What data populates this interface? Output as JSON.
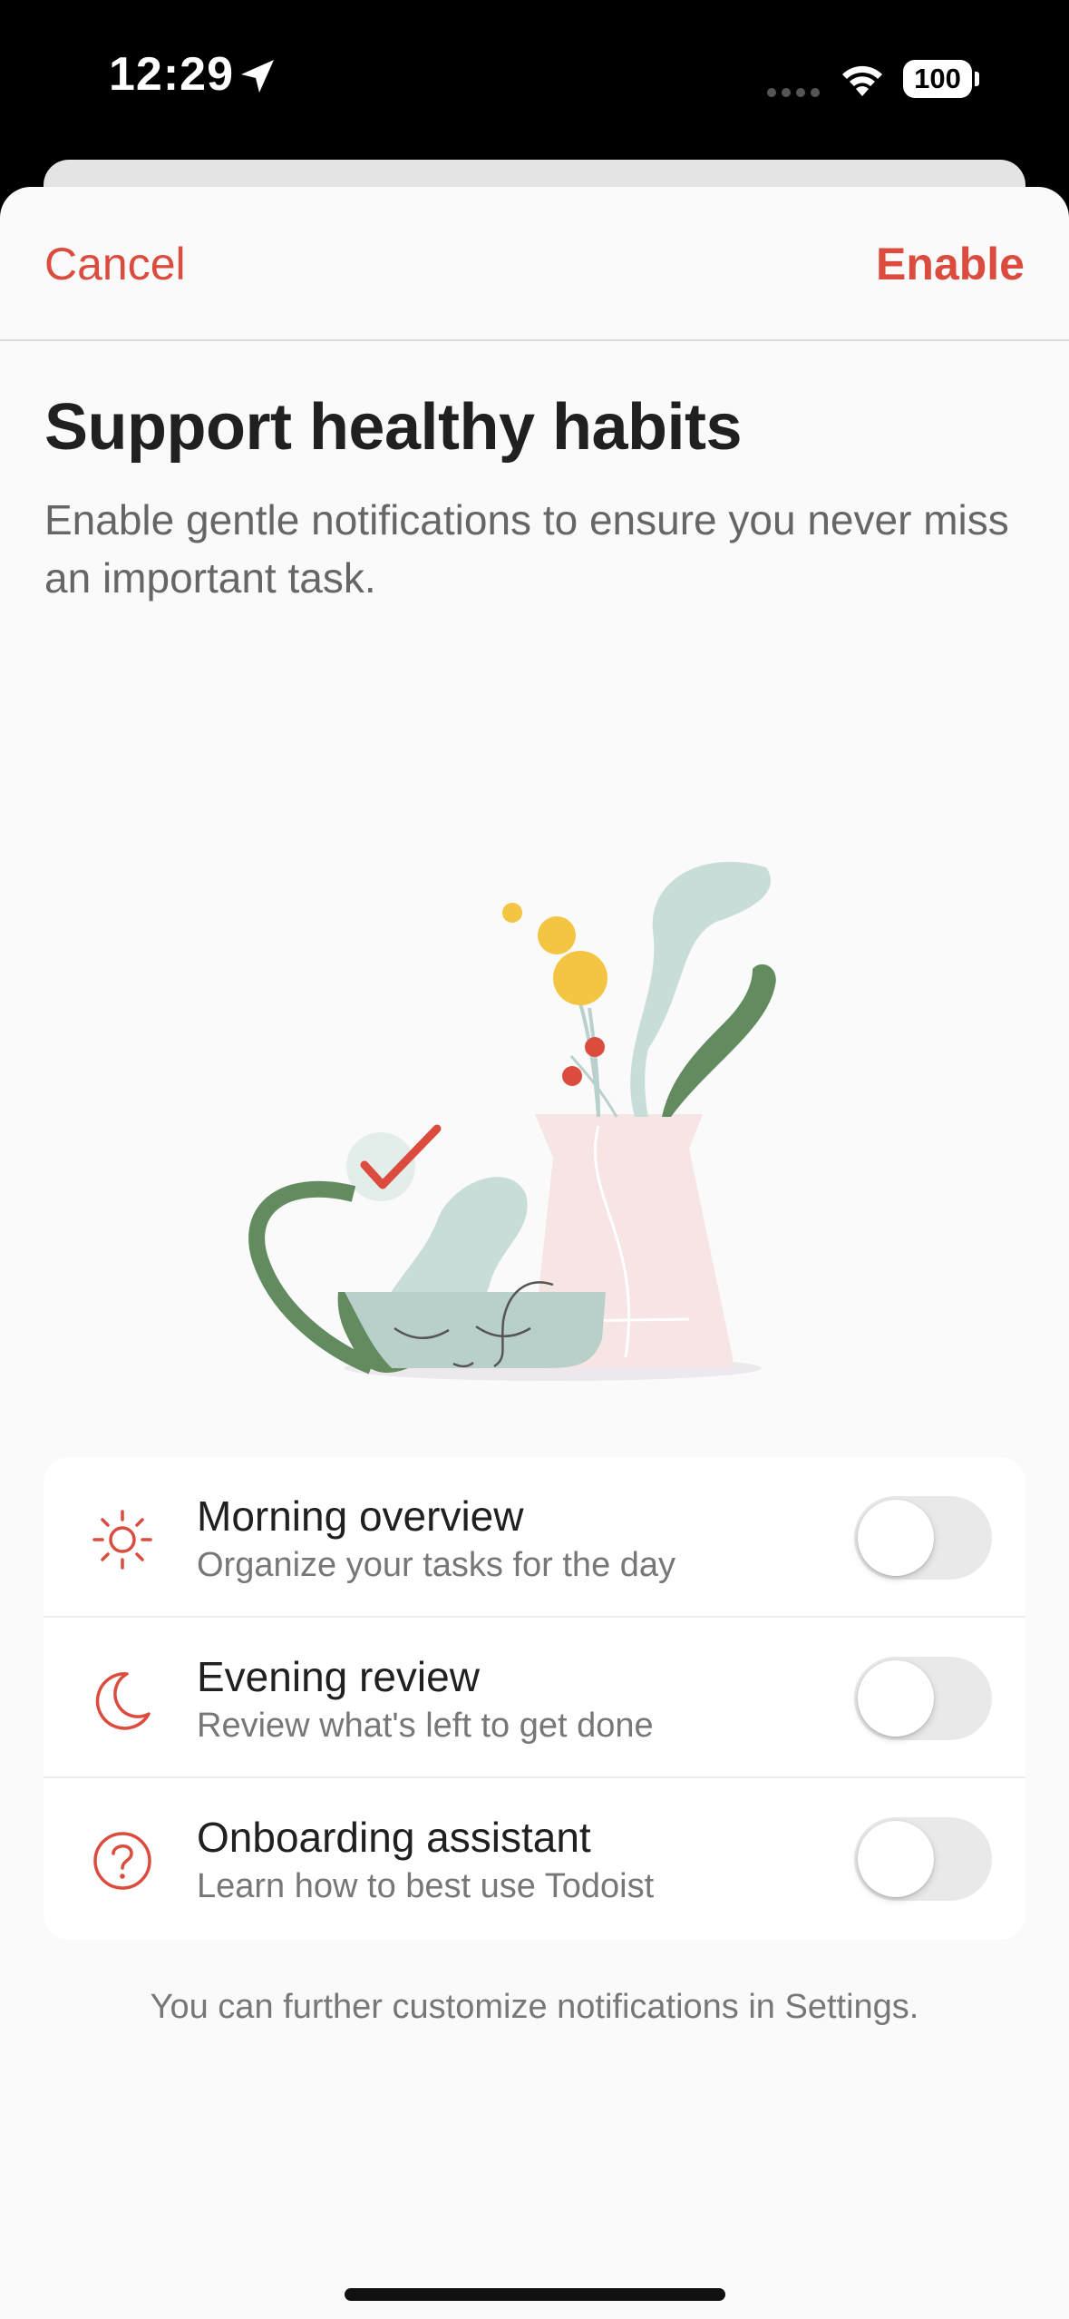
{
  "status_bar": {
    "time": "12:29",
    "battery": "100",
    "location_icon": "location-arrow-icon",
    "wifi_icon": "wifi-icon",
    "battery_icon": "battery-icon"
  },
  "nav": {
    "cancel_label": "Cancel",
    "enable_label": "Enable"
  },
  "header": {
    "title": "Support healthy habits",
    "subtitle": "Enable gentle notifications to ensure you never miss an important task."
  },
  "illustration": {
    "name": "mug-and-vase-illustration"
  },
  "options": [
    {
      "title": "Morning overview",
      "description": "Organize your tasks for the day",
      "icon": "sun-icon",
      "enabled": false
    },
    {
      "title": "Evening review",
      "description": "Review what's left to get done",
      "icon": "moon-icon",
      "enabled": false
    },
    {
      "title": "Onboarding assistant",
      "description": "Learn how to best use Todoist",
      "icon": "question-circle-icon",
      "enabled": false
    }
  ],
  "footer": {
    "note": "You can further customize notifications in Settings."
  },
  "colors": {
    "accent": "#dc4c3e",
    "background": "#fafafa",
    "text_primary": "#202020",
    "text_secondary": "#777777",
    "toggle_off": "#e9e9ea"
  }
}
